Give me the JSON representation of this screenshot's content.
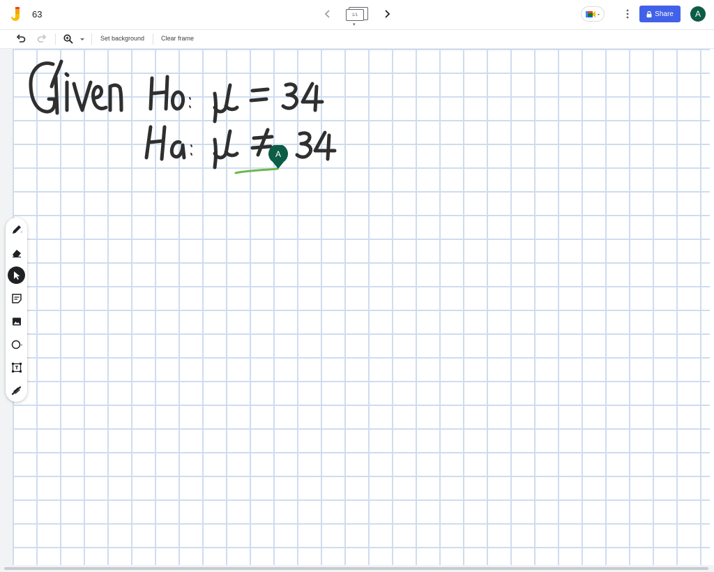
{
  "app": {
    "title": "63",
    "logo_icon": "jamboard-logo-icon"
  },
  "header": {
    "frame_indicator": "1/1",
    "share_label": "Share",
    "avatar_initial": "A",
    "icons": [
      "chevron-left-icon",
      "frames-icon",
      "chevron-right-icon",
      "google-meet-icon",
      "more-vert-icon",
      "lock-icon"
    ]
  },
  "toolbar": {
    "set_background_label": "Set background",
    "clear_frame_label": "Clear frame",
    "icons": [
      "undo-icon",
      "redo-icon",
      "zoom-icon",
      "dropdown-caret-icon"
    ]
  },
  "tools": [
    {
      "name": "pen",
      "icon": "pen-icon",
      "active": false
    },
    {
      "name": "eraser",
      "icon": "eraser-icon",
      "active": false
    },
    {
      "name": "select",
      "icon": "cursor-icon",
      "active": true
    },
    {
      "name": "sticky-note",
      "icon": "sticky-note-icon",
      "active": false
    },
    {
      "name": "image",
      "icon": "image-icon",
      "active": false
    },
    {
      "name": "shape",
      "icon": "circle-icon",
      "active": false
    },
    {
      "name": "text-box",
      "icon": "text-box-icon",
      "active": false
    },
    {
      "name": "laser",
      "icon": "laser-icon",
      "active": false
    }
  ],
  "board": {
    "background": "grid",
    "handwriting_lines": [
      "Given:",
      "Ho: μ = 34",
      "Ha: μ ≠ 34"
    ],
    "collaborator_initial": "A"
  },
  "colors": {
    "share_button": "#4162e8",
    "avatar": "#0d5c45",
    "grid_line": "#cfdcef",
    "ink": "#2f2f2f",
    "highlight": "#6bb84a"
  }
}
